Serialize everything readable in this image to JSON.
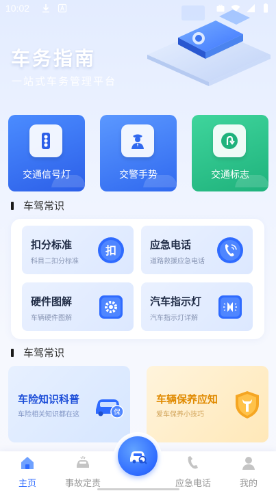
{
  "status_bar": {
    "time": "10:02"
  },
  "header": {
    "title": "车务指南",
    "subtitle": "一站式车务管理平台"
  },
  "tiles": [
    {
      "label": "交通信号灯",
      "icon": "traffic-light-icon"
    },
    {
      "label": "交警手势",
      "icon": "traffic-police-icon"
    },
    {
      "label": "交通标志",
      "icon": "u-turn-sign-icon"
    }
  ],
  "section1": {
    "title": "车驾常识"
  },
  "knowledge": [
    {
      "title": "扣分标准",
      "subtitle": "科目二扣分标准",
      "icon": "deduct-points-icon",
      "icon_text": "扣"
    },
    {
      "title": "应急电话",
      "subtitle": "道路救援应急电话",
      "icon": "phone-call-icon"
    },
    {
      "title": "硬件图解",
      "subtitle": "车辆硬件图解",
      "icon": "gear-icon"
    },
    {
      "title": "汽车指示灯",
      "subtitle": "汽车指示灯详解",
      "icon": "headlight-icon"
    }
  ],
  "section2": {
    "title": "车驾常识"
  },
  "cards": [
    {
      "title": "车险知识科普",
      "subtitle": "车险相关知识都在这",
      "icon": "insured-car-icon",
      "icon_text": "保"
    },
    {
      "title": "车辆保养应知",
      "subtitle": "爱车保养小技巧",
      "icon": "wrench-shield-icon"
    }
  ],
  "tab_bar": {
    "items": [
      {
        "label": "主页",
        "icon": "home-icon",
        "active": true
      },
      {
        "label": "事故定责",
        "icon": "car-accident-icon",
        "active": false
      },
      {
        "label": "应急电话",
        "icon": "phone-icon",
        "active": false
      },
      {
        "label": "我的",
        "icon": "user-icon",
        "active": false
      }
    ],
    "center_icon": "car-search-icon"
  },
  "colors": {
    "primary": "#2f6bff",
    "green_tile": "#1fb27c",
    "insurance_title": "#1d4ed8",
    "maintenance_title": "#e08a00"
  }
}
